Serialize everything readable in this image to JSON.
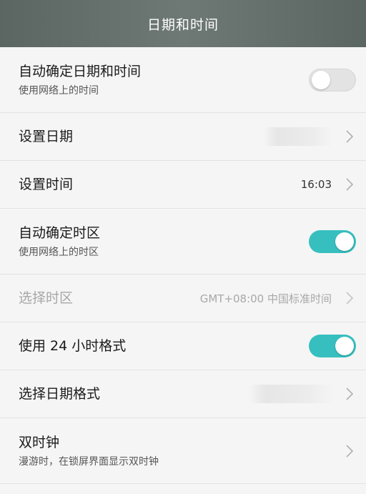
{
  "header": {
    "title": "日期和时间"
  },
  "settings": {
    "auto_datetime": {
      "title": "自动确定日期和时间",
      "subtitle": "使用网络上的时间",
      "enabled": false
    },
    "set_date": {
      "title": "设置日期"
    },
    "set_time": {
      "title": "设置时间",
      "value": "16:03"
    },
    "auto_timezone": {
      "title": "自动确定时区",
      "subtitle": "使用网络上的时区",
      "enabled": true
    },
    "select_timezone": {
      "title": "选择时区",
      "value": "GMT+08:00 中国标准时间"
    },
    "use_24h": {
      "title": "使用 24 小时格式",
      "enabled": true
    },
    "date_format": {
      "title": "选择日期格式"
    },
    "dual_clock": {
      "title": "双时钟",
      "subtitle": "漫游时，在锁屏界面显示双时钟"
    }
  },
  "colors": {
    "toggle_on": "#37bfbf",
    "toggle_off": "#e3e3e3",
    "header_bg": "#636e6a"
  },
  "icons": {
    "chevron": "chevron-right-icon"
  }
}
